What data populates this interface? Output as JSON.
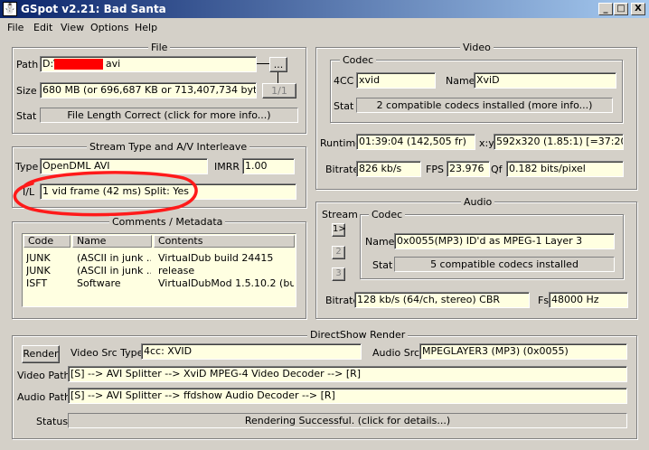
{
  "window": {
    "title": "GSpot v2.21: Bad Santa",
    "controls": [
      "_",
      "□",
      "X"
    ]
  },
  "menu": [
    "File",
    "Edit",
    "View",
    "Options",
    "Help"
  ],
  "file": {
    "legend": "File",
    "path_label": "Path",
    "path_prefix": "D:\\",
    "path_suffix": "avi",
    "browse_label": "...",
    "size_label": "Size",
    "size_value": "680 MB (or 696,687 KB or 713,407,734 bytes)",
    "part_label": "1/1",
    "stat_label": "Stat",
    "stat_value": "File Length Correct (click for more info...)"
  },
  "stream": {
    "legend": "Stream Type and A/V Interleave",
    "type_label": "Type",
    "type_value": "OpenDML AVI",
    "imrr_label": "IMRR",
    "imrr_value": "1.00",
    "il_label": "I/L",
    "il_value": "1 vid frame (42 ms)  Split: Yes"
  },
  "comments": {
    "legend": "Comments / Metadata",
    "headers": [
      "Code",
      "Name",
      "Contents"
    ],
    "rows": [
      [
        "JUNK",
        "(ASCII in junk ...",
        "VirtualDub build 24415"
      ],
      [
        "JUNK",
        "(ASCII in junk ...",
        "release"
      ],
      [
        "ISFT",
        "Software",
        "VirtualDubMod 1.5.10.2 (buil..."
      ]
    ]
  },
  "video": {
    "legend": "Video",
    "codec_legend": "Codec",
    "fourcc_label": "4CC",
    "fourcc_value": "xvid",
    "name_label": "Name",
    "name_value": "XviD",
    "stat_label": "Stat",
    "stat_value": "2 compatible codecs installed (more info...)",
    "runtime_label": "Runtime",
    "runtime_value": "01:39:04 (142,505 fr)",
    "xy_label": "x:y",
    "xy_value": "592x320 (1.85:1) [=37:20]",
    "bitrate_label": "Bitrate",
    "bitrate_value": "826 kb/s",
    "fps_label": "FPS",
    "fps_value": "23.976",
    "qf_label": "Qf",
    "qf_value": "0.182 bits/pixel"
  },
  "audio": {
    "legend": "Audio",
    "stream_label": "Stream",
    "stream_buttons": [
      "1>",
      "2",
      "3"
    ],
    "codec_legend": "Codec",
    "name_label": "Name",
    "name_value": "0x0055(MP3) ID'd as MPEG-1 Layer 3",
    "stat_label": "Stat",
    "stat_value": "5 compatible codecs installed",
    "bitrate_label": "Bitrate",
    "bitrate_value": "128 kb/s (64/ch, stereo) CBR",
    "fs_label": "Fs",
    "fs_value": "48000 Hz"
  },
  "directshow": {
    "legend": "DirectShow Render",
    "render_label": "Render",
    "video_src_label": "Video Src Type",
    "video_src_value": "4cc: XVID",
    "audio_src_label": "Audio Src",
    "audio_src_value": "MPEGLAYER3 (MP3) (0x0055)",
    "video_path_label": "Video Path",
    "video_path_value": "[S] --> AVI Splitter --> XviD MPEG-4 Video Decoder --> [R]",
    "audio_path_label": "Audio Path",
    "audio_path_value": "[S] --> AVI Splitter --> ffdshow Audio Decoder --> [R]",
    "status_label": "Status",
    "status_value": "Rendering Successful.  (click for details...)"
  },
  "colors": {
    "title_gradient_start": "#0a246a",
    "title_gradient_end": "#a6caf0",
    "field_bg": "#ffffe1",
    "annotation_circle": "#ff1a1a",
    "redaction": "#ff0000"
  }
}
